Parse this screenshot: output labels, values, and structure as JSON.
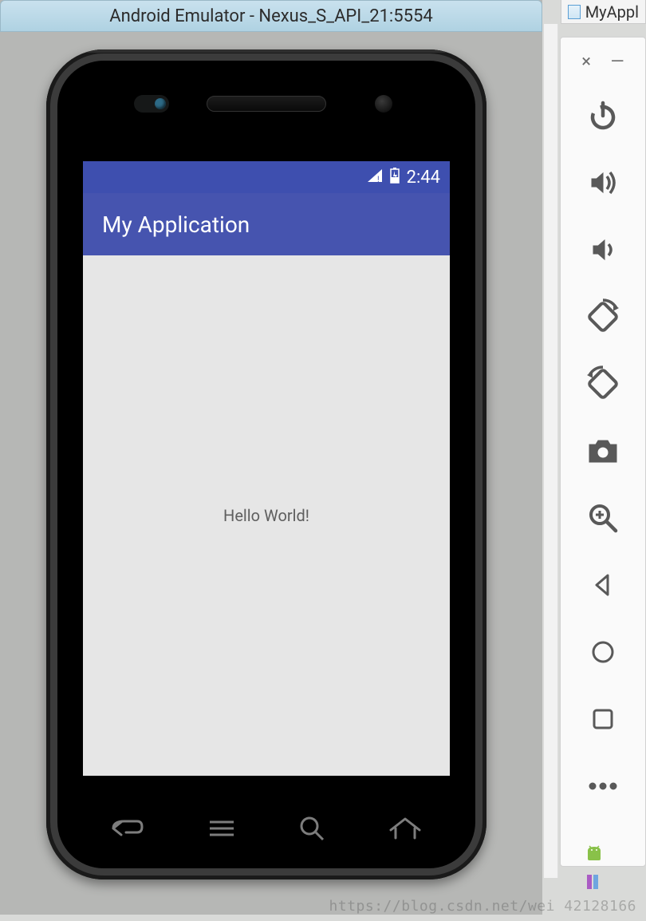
{
  "emulator": {
    "title": "Android Emulator - Nexus_S_API_21:5554"
  },
  "statusbar": {
    "time": "2:44"
  },
  "app": {
    "title": "My Application",
    "content_text": "Hello World!"
  },
  "side_toolbar": {
    "close_glyph": "×",
    "minimize_glyph": "—"
  },
  "ide": {
    "tab_label": "MyAppl"
  },
  "watermark": "https://blog.csdn.net/wei   42128166"
}
